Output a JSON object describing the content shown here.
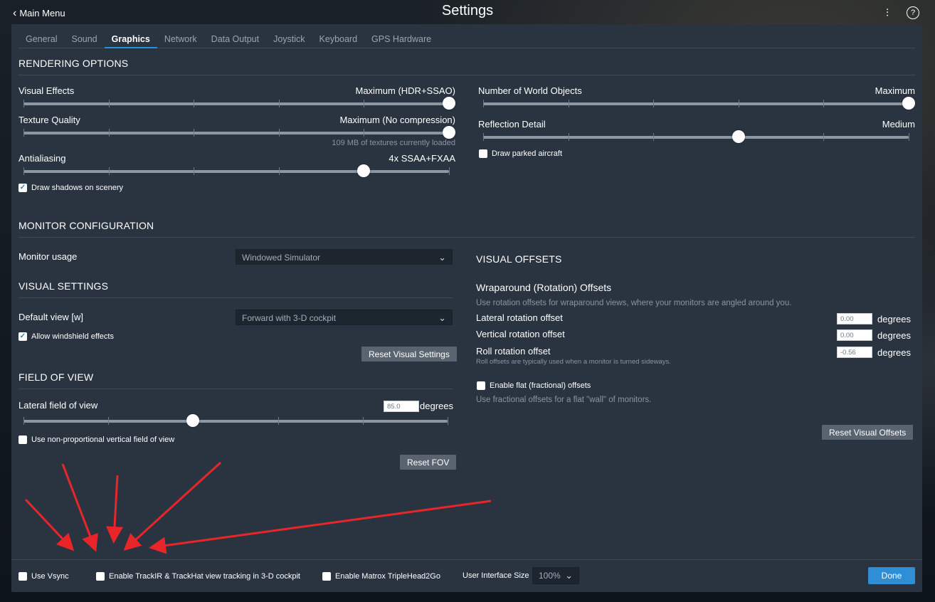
{
  "window": {
    "title": "Settings",
    "back_label": "Main Menu"
  },
  "tabs": [
    {
      "label": "General"
    },
    {
      "label": "Sound"
    },
    {
      "label": "Graphics",
      "active": true
    },
    {
      "label": "Network"
    },
    {
      "label": "Data Output"
    },
    {
      "label": "Joystick"
    },
    {
      "label": "Keyboard"
    },
    {
      "label": "GPS Hardware"
    }
  ],
  "rendering": {
    "heading": "RENDERING OPTIONS",
    "visual_effects": {
      "label": "Visual Effects",
      "value": "Maximum (HDR+SSAO)",
      "level": 1.0
    },
    "texture_quality": {
      "label": "Texture Quality",
      "value": "Maximum (No compression)",
      "level": 1.0,
      "note": "109 MB of textures currently loaded"
    },
    "antialiasing": {
      "label": "Antialiasing",
      "value": "4x SSAA+FXAA",
      "level": 0.8
    },
    "draw_shadows": {
      "label": "Draw shadows on scenery",
      "checked": true
    },
    "world_objects": {
      "label": "Number of World Objects",
      "value": "Maximum",
      "level": 1.0
    },
    "reflection_detail": {
      "label": "Reflection Detail",
      "value": "Medium",
      "level": 0.6
    },
    "draw_parked": {
      "label": "Draw parked aircraft",
      "checked": false
    }
  },
  "monitor": {
    "heading": "MONITOR CONFIGURATION",
    "usage_label": "Monitor usage",
    "usage_value": "Windowed Simulator"
  },
  "visual_settings": {
    "heading": "VISUAL SETTINGS",
    "default_view_label": "Default view [w]",
    "default_view_value": "Forward with 3-D cockpit",
    "windshield": {
      "label": "Allow windshield effects",
      "checked": true
    },
    "reset_label": "Reset Visual Settings"
  },
  "fov": {
    "heading": "FIELD OF VIEW",
    "lateral_label": "Lateral field of view",
    "lateral_value": "85.0",
    "unit": "degrees",
    "level": 0.4,
    "nonprop": {
      "label": "Use non-proportional vertical field of view",
      "checked": false
    },
    "reset_label": "Reset FOV"
  },
  "visual_offsets": {
    "heading": "VISUAL OFFSETS",
    "wrap_heading": "Wraparound (Rotation) Offsets",
    "wrap_desc": "Use rotation offsets for wraparound views, where your monitors are angled around you.",
    "lateral": {
      "label": "Lateral rotation offset",
      "value": "0.00",
      "unit": "degrees"
    },
    "vertical": {
      "label": "Vertical rotation offset",
      "value": "0.00",
      "unit": "degrees"
    },
    "roll": {
      "label": "Roll rotation offset",
      "value": "-0.56",
      "unit": "degrees"
    },
    "roll_note": "Roll offsets are typically used when a monitor is turned sideways.",
    "flat": {
      "label": "Enable flat (fractional) offsets",
      "checked": false
    },
    "flat_desc": "Use fractional offsets for a flat \"wall\" of monitors.",
    "reset_label": "Reset Visual Offsets"
  },
  "bottom": {
    "vsync": {
      "label": "Use Vsync",
      "checked": false
    },
    "trackir": {
      "label": "Enable TrackIR & TrackHat view tracking in 3-D cockpit",
      "checked": false
    },
    "matrox": {
      "label": "Enable Matrox TripleHead2Go",
      "checked": false
    },
    "ui_size_label": "User Interface Size",
    "ui_size_value": "100%",
    "done_label": "Done"
  },
  "colors": {
    "panel": "#2a3440",
    "accent": "#2f8fd6",
    "annotation_arrow": "#e8262a"
  },
  "icons": [
    "chevron-left-icon",
    "sliders-icon",
    "help-icon",
    "chevron-down-icon",
    "checkmark-icon"
  ]
}
